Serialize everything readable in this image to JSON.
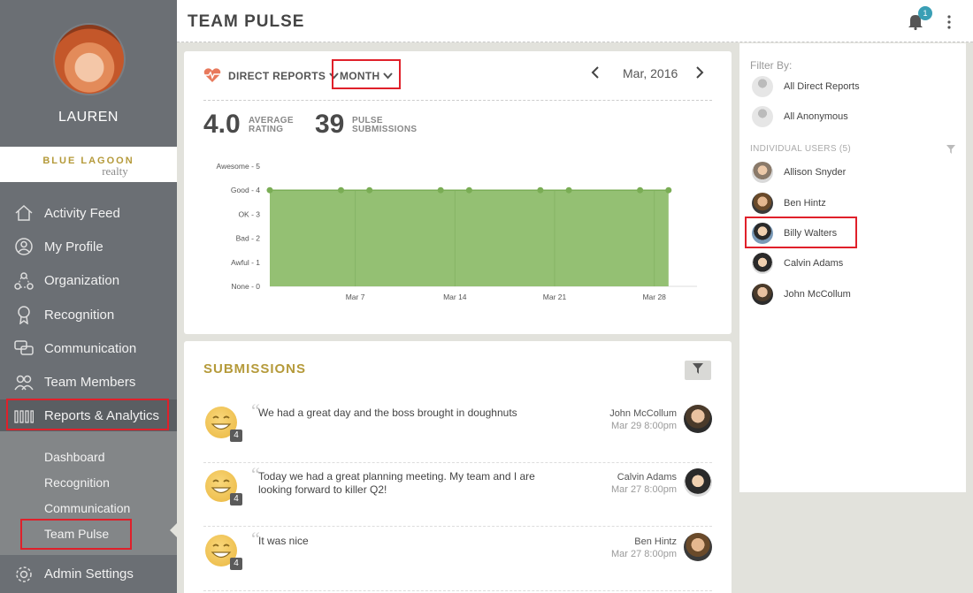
{
  "sidebar": {
    "user_name": "LAUREN",
    "brand_line1": "BLUE LAGOON",
    "brand_line2": "realty",
    "items": [
      {
        "label": "Activity Feed",
        "icon": "home-icon"
      },
      {
        "label": "My Profile",
        "icon": "person-icon"
      },
      {
        "label": "Organization",
        "icon": "org-icon"
      },
      {
        "label": "Recognition",
        "icon": "ribbon-icon"
      },
      {
        "label": "Communication",
        "icon": "chat-icon"
      },
      {
        "label": "Team Members",
        "icon": "group-icon"
      },
      {
        "label": "Reports & Analytics",
        "icon": "bars-icon"
      }
    ],
    "sub_items": [
      {
        "label": "Dashboard"
      },
      {
        "label": "Recognition"
      },
      {
        "label": "Communication"
      },
      {
        "label": "Team Pulse"
      }
    ],
    "admin_label": "Admin Settings"
  },
  "header": {
    "title": "TEAM PULSE",
    "notification_count": "1"
  },
  "pulse": {
    "scope_label": "DIRECT REPORTS",
    "period_label": "MONTH",
    "date_label": "Mar, 2016",
    "avg_rating": "4.0",
    "avg_label_1": "AVERAGE",
    "avg_label_2": "RATING",
    "submissions": "39",
    "sub_label_1": "PULSE",
    "sub_label_2": "SUBMISSIONS",
    "accent_color": "#e8795c",
    "chart_color": "#94c073"
  },
  "chart_data": {
    "type": "area",
    "y_ticks": [
      "None - 0",
      "Awful - 1",
      "Bad - 2",
      "OK - 3",
      "Good - 4",
      "Awesome - 5"
    ],
    "ylim": [
      0,
      5
    ],
    "x_ticks": [
      {
        "day": 7,
        "label": "Mar 7"
      },
      {
        "day": 14,
        "label": "Mar 14"
      },
      {
        "day": 21,
        "label": "Mar 21"
      },
      {
        "day": 28,
        "label": "Mar 28"
      }
    ],
    "xlim": [
      1,
      31
    ],
    "x": [
      1,
      6,
      8,
      13,
      15,
      20,
      22,
      27,
      29
    ],
    "values": [
      4,
      4,
      4,
      4,
      4,
      4,
      4,
      4,
      4
    ]
  },
  "submissions": {
    "title": "SUBMISSIONS",
    "items": [
      {
        "message": "We had a great day and the boss brought in doughnuts",
        "author": "John McCollum",
        "time": "Mar 29 8:00pm",
        "rating": "4"
      },
      {
        "message": "Today we had a great planning meeting. My team and I are looking forward to killer Q2!",
        "author": "Calvin Adams",
        "time": "Mar 27 8:00pm",
        "rating": "4"
      },
      {
        "message": "It was nice",
        "author": "Ben Hintz",
        "time": "Mar 27 8:00pm",
        "rating": "4"
      }
    ]
  },
  "filter_panel": {
    "title": "Filter By:",
    "groups": [
      {
        "label": "All Direct Reports"
      },
      {
        "label": "All Anonymous"
      }
    ],
    "individual_label": "INDIVIDUAL USERS (5)",
    "users": [
      {
        "label": "Allison Snyder"
      },
      {
        "label": "Ben Hintz"
      },
      {
        "label": "Billy Walters"
      },
      {
        "label": "Calvin Adams"
      },
      {
        "label": "John McCollum"
      }
    ]
  }
}
